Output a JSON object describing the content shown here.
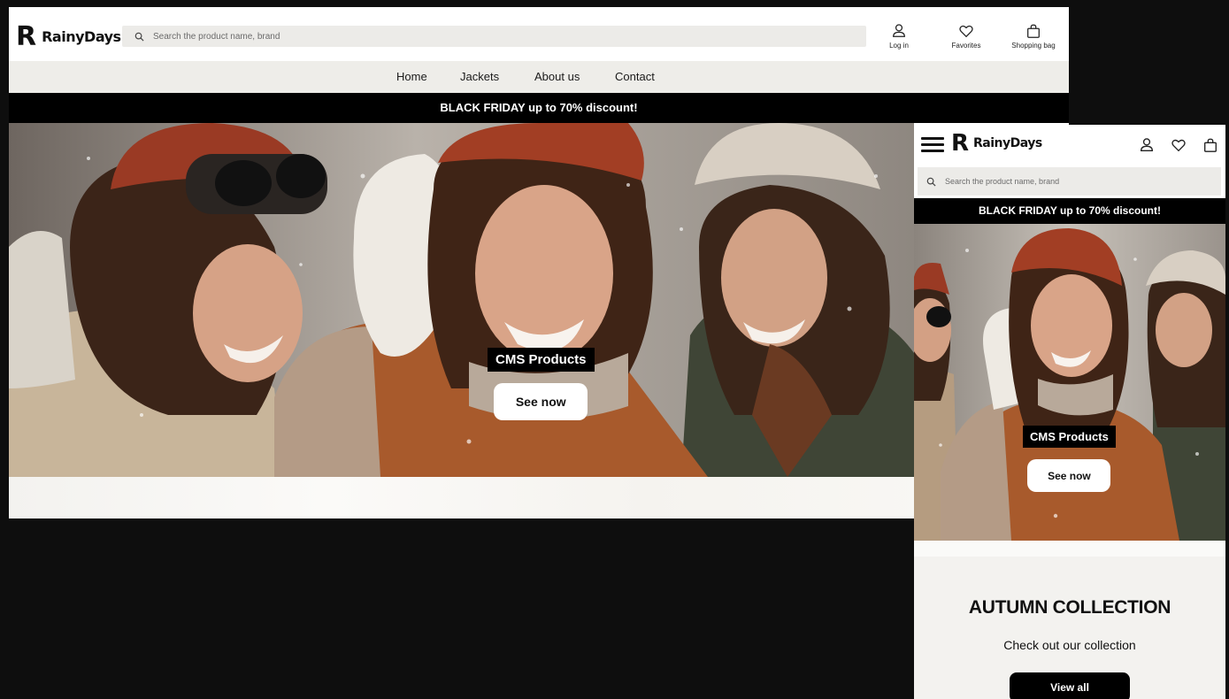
{
  "brand": {
    "logo_mark": "R",
    "name": "RainyDays"
  },
  "search": {
    "placeholder": "Search the product name, brand"
  },
  "actions": {
    "login": "Log in",
    "favorites": "Favorites",
    "bag": "Shopping bag"
  },
  "nav": {
    "items": [
      "Home",
      "Jackets",
      "About us",
      "Contact"
    ]
  },
  "promo": {
    "text": "BLACK FRIDAY up to 70% discount!"
  },
  "hero": {
    "label": "CMS Products",
    "button": "See now"
  },
  "collection": {
    "title": "AUTUMN COLLECTION",
    "subtitle": "Check out our collection",
    "button": "View all"
  },
  "colors": {
    "page_background": "#0e0e0e",
    "banner": "#000000",
    "search_field": "#ecebe8",
    "nav_background": "#eeede9",
    "hat_red": "#9a3a24",
    "jacket_rust": "#a85a2c"
  },
  "icons": [
    "search-icon",
    "user-icon",
    "heart-icon",
    "shopping-bag-icon",
    "hamburger-menu-icon"
  ]
}
